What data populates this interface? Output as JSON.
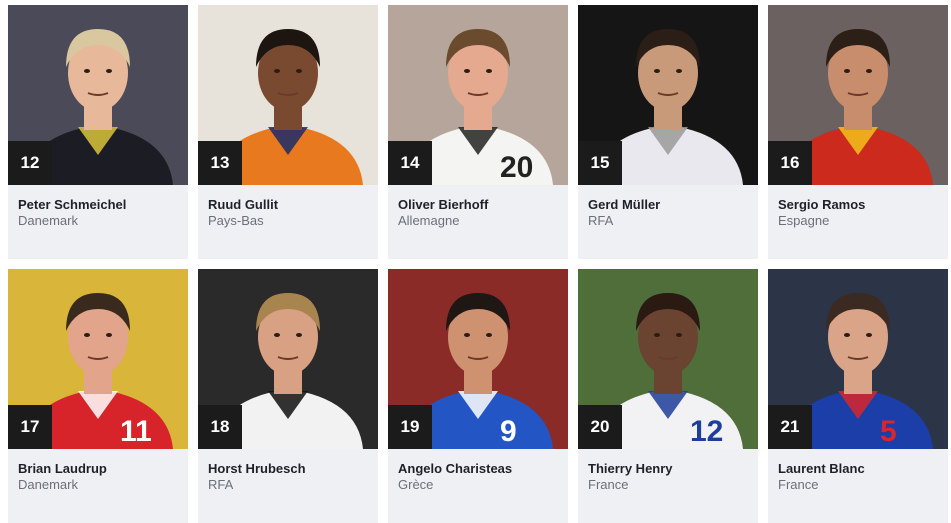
{
  "players": [
    {
      "rank": "12",
      "name": "Peter Schmeichel",
      "country": "Danemark",
      "bg": "#4b4a58",
      "skin": "#e8b89a",
      "hair": "#d9c7a0",
      "shirt": "#1c1c24",
      "accent": "#d8c43a"
    },
    {
      "rank": "13",
      "name": "Ruud Gullit",
      "country": "Pays-Bas",
      "bg": "#e7e2da",
      "skin": "#7a4a30",
      "hair": "#1d1510",
      "shirt": "#e9791f",
      "accent": "#1b2b6b"
    },
    {
      "rank": "14",
      "name": "Oliver Bierhoff",
      "country": "Allemagne",
      "bg": "#b6a59a",
      "skin": "#e4a98e",
      "hair": "#6b4b2e",
      "shirt": "#f4f4f2",
      "accent": "#222222"
    },
    {
      "rank": "15",
      "name": "Gerd Müller",
      "country": "RFA",
      "bg": "#151515",
      "skin": "#c99a7a",
      "hair": "#2a1e16",
      "shirt": "#e8e8ee",
      "accent": "#9a9a9a"
    },
    {
      "rank": "16",
      "name": "Sergio Ramos",
      "country": "Espagne",
      "bg": "#6a6160",
      "skin": "#c88d6c",
      "hair": "#2b1f17",
      "shirt": "#cc2a1c",
      "accent": "#f2c21a"
    },
    {
      "rank": "17",
      "name": "Brian Laudrup",
      "country": "Danemark",
      "bg": "#d9b63a",
      "skin": "#e2a48a",
      "hair": "#3a2a1e",
      "shirt": "#d7242a",
      "accent": "#ffffff"
    },
    {
      "rank": "18",
      "name": "Horst Hrubesch",
      "country": "RFA",
      "bg": "#2a2a2a",
      "skin": "#d8a184",
      "hair": "#a8844e",
      "shirt": "#f2f2f2",
      "accent": "#111111"
    },
    {
      "rank": "19",
      "name": "Angelo Charisteas",
      "country": "Grèce",
      "bg": "#8a2b28",
      "skin": "#cf9270",
      "hair": "#1f1713",
      "shirt": "#2356c4",
      "accent": "#ffffff"
    },
    {
      "rank": "20",
      "name": "Thierry Henry",
      "country": "France",
      "bg": "#4f6e3a",
      "skin": "#6a4430",
      "hair": "#2a1a12",
      "shirt": "#f2f2f4",
      "accent": "#1f3d9a"
    },
    {
      "rank": "21",
      "name": "Laurent Blanc",
      "country": "France",
      "bg": "#2c3548",
      "skin": "#d9a487",
      "hair": "#3a2a22",
      "shirt": "#1b3ea8",
      "accent": "#d8262a"
    }
  ],
  "jersey_numbers": [
    "",
    "",
    "20",
    "",
    "",
    "11",
    "",
    "9",
    "12",
    "5"
  ]
}
